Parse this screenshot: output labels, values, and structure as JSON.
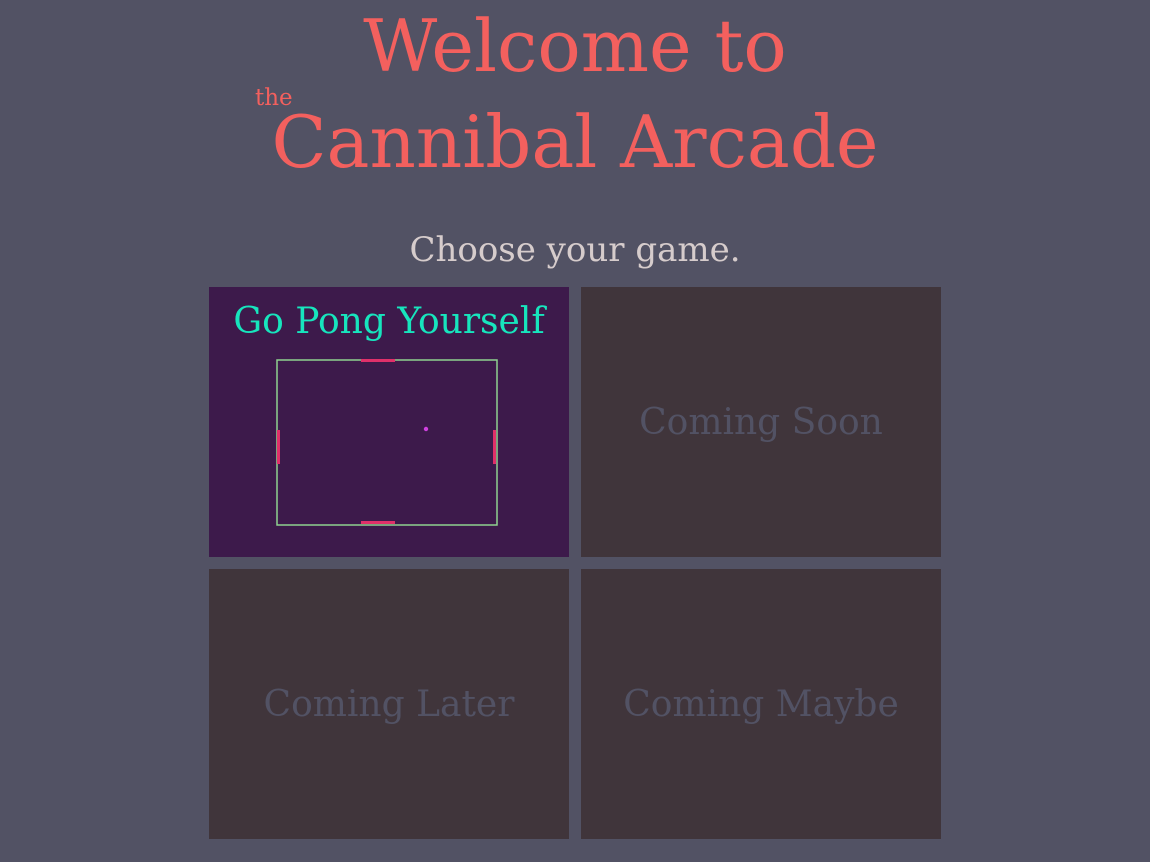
{
  "header": {
    "title_line1": "Welcome to",
    "title_small": "the",
    "title_line2": "Cannibal Arcade",
    "subtitle": "Choose your game."
  },
  "games": [
    {
      "title": "Go Pong Yourself"
    },
    {
      "label": "Coming Soon"
    },
    {
      "label": "Coming Later"
    },
    {
      "label": "Coming Maybe"
    }
  ],
  "colors": {
    "background": "#525264",
    "title": "#f3605e",
    "subtitle": "#d6cccc",
    "active_tile": "#3d1a4b",
    "inactive_tile": "#40353b",
    "pong_title": "#17e5bd",
    "pong_border": "#8fd18f",
    "paddle": "#e0306a",
    "ball": "#d040e0"
  },
  "icons": {
    "pong_preview": "pong-game-preview"
  }
}
